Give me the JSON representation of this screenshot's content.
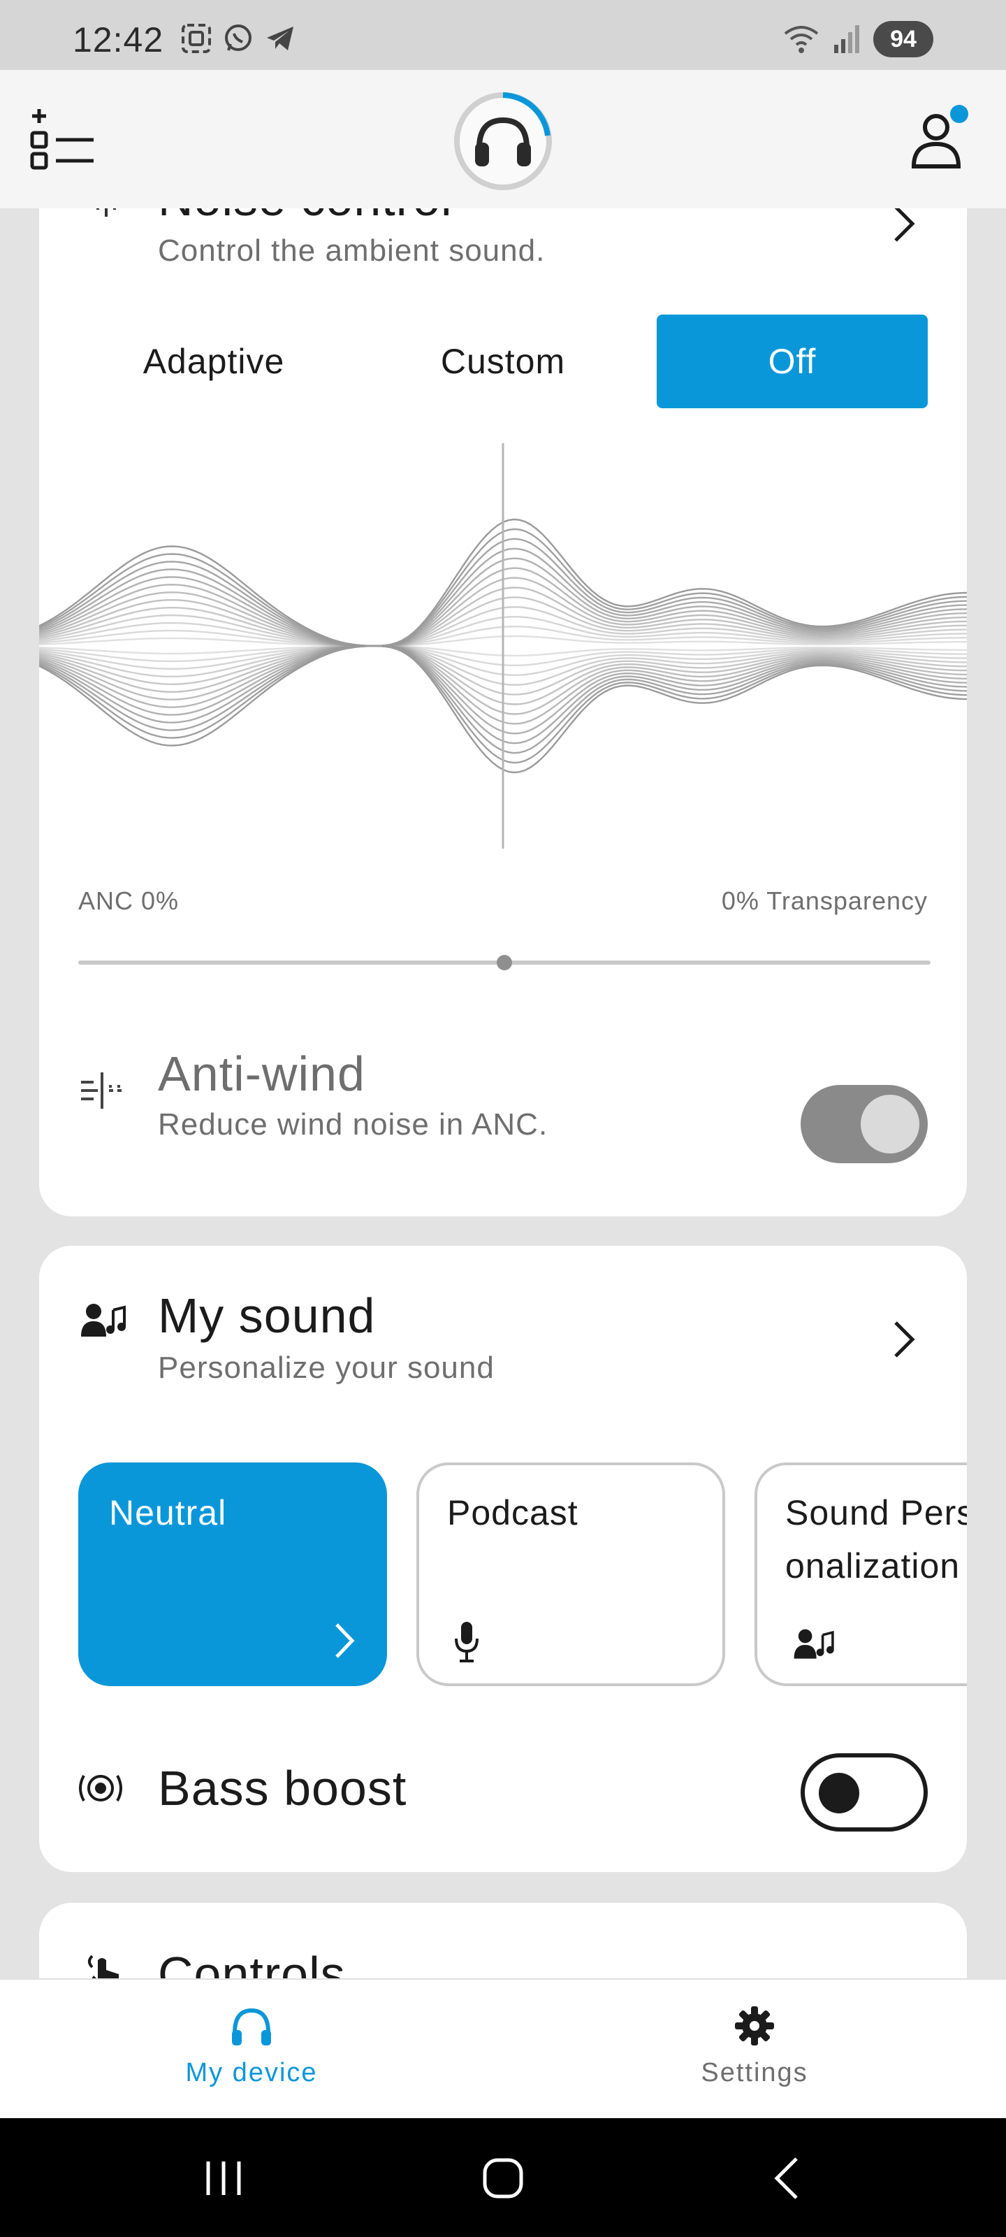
{
  "status_bar": {
    "time": "12:42",
    "battery": "94"
  },
  "header": {
    "menu_icon": "add-list-icon",
    "device_icon": "headphones-icon",
    "profile_icon": "user-icon"
  },
  "noise_control": {
    "title": "Noise control",
    "subtitle": "Control the ambient sound.",
    "modes": [
      "Adaptive",
      "Custom",
      "Off"
    ],
    "selected_mode": "Off",
    "anc_label": "ANC 0%",
    "transparency_label": "0% Transparency",
    "slider_position": 0.5,
    "anti_wind": {
      "title": "Anti-wind",
      "subtitle": "Reduce wind noise in ANC.",
      "enabled": true
    }
  },
  "my_sound": {
    "title": "My sound",
    "subtitle": "Personalize your sound",
    "presets": [
      {
        "label": "Neutral",
        "active": true
      },
      {
        "label": "Podcast",
        "active": false
      },
      {
        "label": "Sound Personalization",
        "active": false
      }
    ],
    "bass_boost": {
      "title": "Bass boost",
      "enabled": false
    }
  },
  "controls": {
    "title": "Controls"
  },
  "bottom_nav": {
    "items": [
      {
        "label": "My device",
        "icon": "headphones-icon",
        "active": true
      },
      {
        "label": "Settings",
        "icon": "gear-icon",
        "active": false
      }
    ]
  },
  "colors": {
    "accent": "#0a97d9",
    "background": "#e3e3e3",
    "card": "#ffffff"
  }
}
